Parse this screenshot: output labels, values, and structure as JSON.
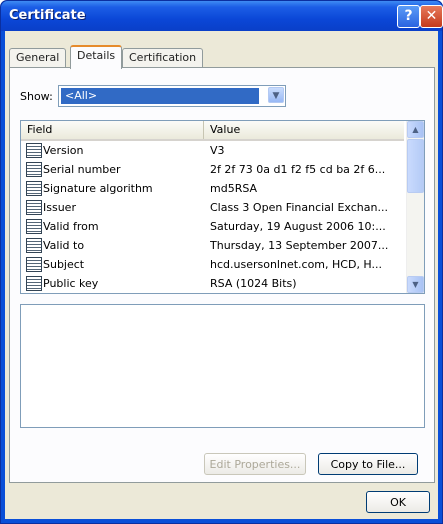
{
  "window": {
    "title": "Certificate",
    "help_glyph": "?",
    "close_glyph": "✕"
  },
  "tabs": [
    {
      "label": "General"
    },
    {
      "label": "Details"
    },
    {
      "label": "Certification Path"
    }
  ],
  "show": {
    "label": "Show:",
    "value": "<All>"
  },
  "list": {
    "columns": {
      "field": "Field",
      "value": "Value"
    },
    "rows": [
      {
        "field": "Version",
        "value": "V3"
      },
      {
        "field": "Serial number",
        "value": "2f 2f 73 0a d1 f2 f5 cd ba 2f 6..."
      },
      {
        "field": "Signature algorithm",
        "value": "md5RSA"
      },
      {
        "field": "Issuer",
        "value": "Class 3 Open Financial Exchan..."
      },
      {
        "field": "Valid from",
        "value": "Saturday, 19 August 2006 10:..."
      },
      {
        "field": "Valid to",
        "value": "Thursday, 13 September 2007..."
      },
      {
        "field": "Subject",
        "value": "hcd.usersonlnet.com, HCD, H..."
      },
      {
        "field": "Public key",
        "value": "RSA (1024 Bits)"
      }
    ]
  },
  "buttons": {
    "edit_properties": "Edit Properties...",
    "copy_to_file": "Copy to File...",
    "ok": "OK"
  },
  "icons": {
    "select_arrow": "chevron-down-icon",
    "scroll_up": "chevron-up-icon",
    "scroll_down": "chevron-down-icon",
    "row_icon": "certificate-field-icon"
  },
  "colors": {
    "titlebar": "#0b47d7",
    "selection": "#316ac5",
    "dialog_bg": "#ece9d8"
  }
}
